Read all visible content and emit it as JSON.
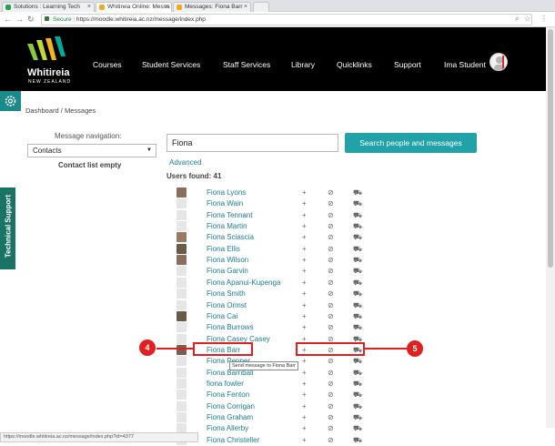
{
  "browser": {
    "tabs": [
      {
        "label": "Solutions : Learning Tech",
        "fav_color": "#27a34a"
      },
      {
        "label": "Whitireia Online: Messa",
        "fav_color": "#f5a623"
      },
      {
        "label": "Messages: Fiona Barr",
        "fav_color": "#f5a623"
      }
    ],
    "secure_label": "Secure",
    "url": "https://moodle.whitireia.ac.nz/message/index.php"
  },
  "header": {
    "logo_text": "Whitireia",
    "logo_sub": "NEW ZEALAND",
    "nav": [
      "Courses",
      "Student Services",
      "Staff Services",
      "Library",
      "Quicklinks",
      "Support"
    ],
    "user_name": "Ima Student"
  },
  "sidebar": {
    "tech_support_label": "Technical Support"
  },
  "breadcrumb": {
    "items": [
      "Dashboard",
      "Messages"
    ],
    "separator": "/"
  },
  "message_nav": {
    "label": "Message navigation:",
    "selected": "Contacts",
    "empty_text": "Contact list empty"
  },
  "search": {
    "value": "Fiona",
    "button_label": "Search people and messages",
    "advanced_label": "Advanced",
    "users_found": "Users found: 41"
  },
  "results": [
    {
      "name": "Fiona Lyons",
      "has_photo": true
    },
    {
      "name": "Fiona Wain",
      "has_photo": false
    },
    {
      "name": "Fiona Tennant",
      "has_photo": false
    },
    {
      "name": "Fiona Martin",
      "has_photo": false
    },
    {
      "name": "Fiona Sciascia",
      "has_photo": true
    },
    {
      "name": "Fiona Ellis",
      "has_photo": true
    },
    {
      "name": "Fiona Wilson",
      "has_photo": true
    },
    {
      "name": "Fiona Garvin",
      "has_photo": false
    },
    {
      "name": "Fiona Apanui-Kupenga",
      "has_photo": false
    },
    {
      "name": "Fiona Smith",
      "has_photo": false
    },
    {
      "name": "Fiona Ormst",
      "has_photo": false
    },
    {
      "name": "Fiona Cai",
      "has_photo": true
    },
    {
      "name": "Fiona Burrows",
      "has_photo": false
    },
    {
      "name": "Fiona Casey Casey",
      "has_photo": false
    },
    {
      "name": "Fiona Barr",
      "has_photo": true
    },
    {
      "name": "Fiona Pepper",
      "has_photo": false
    },
    {
      "name": "Fiona Barriball",
      "has_photo": false
    },
    {
      "name": "fiona fowler",
      "has_photo": false
    },
    {
      "name": "Fiona Fenton",
      "has_photo": false
    },
    {
      "name": "Fiona Corrigan",
      "has_photo": false
    },
    {
      "name": "Fiona Graham",
      "has_photo": false
    },
    {
      "name": "Fiona Allerby",
      "has_photo": false
    },
    {
      "name": "Fiona Christeller",
      "has_photo": false
    }
  ],
  "actions": {
    "add": "+",
    "block": "⊘",
    "message": "⛟"
  },
  "tooltip": "Send message to Fiona Barr",
  "callouts": [
    "4",
    "5"
  ],
  "statusbar": "https://moodle.whitireia.ac.nz/message/index.php?id=4377",
  "colors": {
    "accent": "#20a2a8",
    "link": "#1a7e92",
    "callout": "#e02020"
  }
}
